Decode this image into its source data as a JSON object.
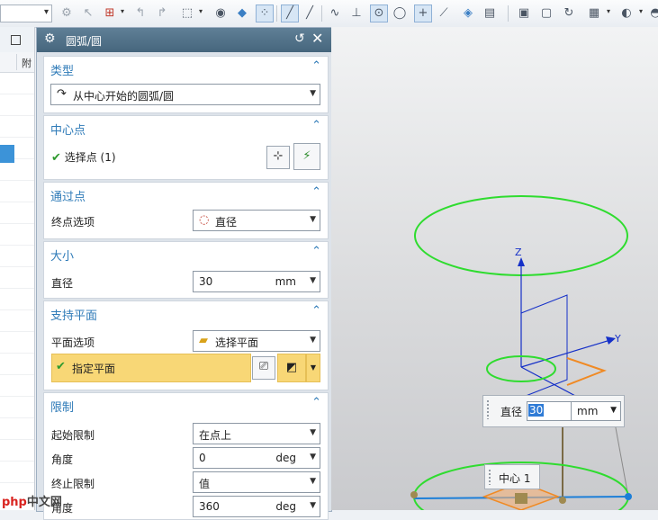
{
  "toolbar": {
    "combo_value": "",
    "icons": [
      "sketch-icon",
      "curve-icon",
      "point-icon",
      "line-icon",
      "arc-icon",
      "box-icon",
      "cube-icon",
      "snap-icon",
      "line-tool-icon",
      "slash-icon",
      "spline-icon",
      "cross-icon",
      "circle-point-icon",
      "circle-icon",
      "plus-icon",
      "line-slash-icon",
      "surface-icon",
      "book-icon",
      "view-icon",
      "window-icon",
      "refresh-icon",
      "layout-icon",
      "render-icon",
      "more-icon"
    ]
  },
  "left_panel": {
    "column_label": "附"
  },
  "dialog": {
    "title": "圆弧/圆",
    "sections": {
      "type": {
        "header": "类型",
        "value": "从中心开始的圆弧/圆"
      },
      "center": {
        "header": "中心点",
        "select_point": "选择点 (1)"
      },
      "through": {
        "header": "通过点",
        "label": "终点选项",
        "value": "直径"
      },
      "size": {
        "header": "大小",
        "label": "直径",
        "value": "30",
        "unit": "mm"
      },
      "plane": {
        "header": "支持平面",
        "label": "平面选项",
        "value": "选择平面",
        "specify": "指定平面"
      },
      "limits": {
        "header": "限制",
        "start_label": "起始限制",
        "start_value": "在点上",
        "angle1_label": "角度",
        "angle1_value": "0",
        "angle1_unit": "deg",
        "end_label": "终止限制",
        "end_value": "值",
        "angle2_label": "角度",
        "angle2_value": "360",
        "angle2_unit": "deg"
      }
    }
  },
  "viewport": {
    "diameter_label": "直径",
    "diameter_value": "30",
    "diameter_unit": "mm",
    "center_label": "中心 1",
    "axis_z": "Z",
    "axis_y": "Y",
    "colors": {
      "circle": "#2fdc2f",
      "plane": "#f08a24",
      "axis": "#1530c8"
    }
  },
  "watermark": {
    "text": "中文网",
    "logo": "php"
  }
}
